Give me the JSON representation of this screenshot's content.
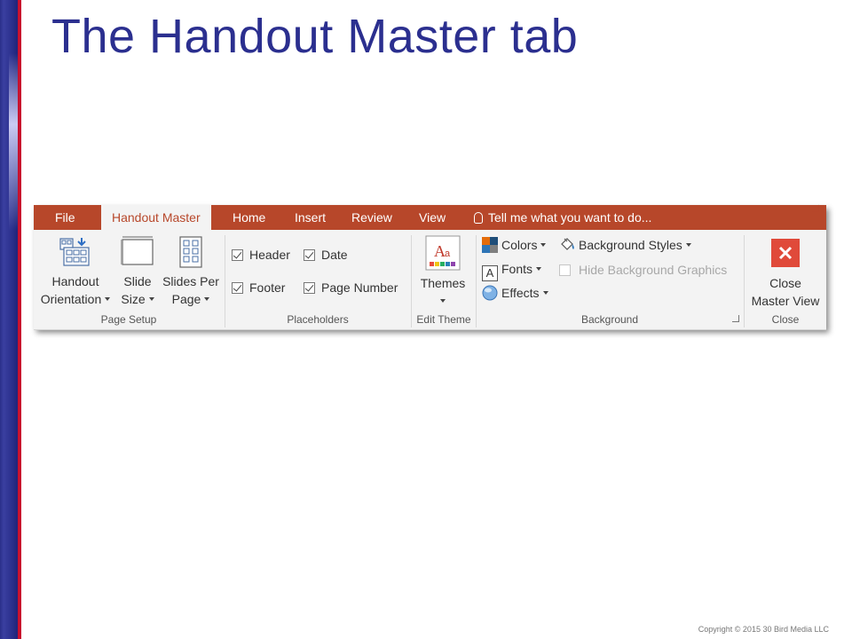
{
  "slide": {
    "title": "The Handout Master tab",
    "copyright": "Copyright © 2015 30 Bird Media LLC"
  },
  "tabs": {
    "file": "File",
    "handout_master": "Handout Master",
    "home": "Home",
    "insert": "Insert",
    "review": "Review",
    "view": "View",
    "tell_me": "Tell me what you want to do..."
  },
  "page_setup": {
    "label": "Page Setup",
    "orientation_line1": "Handout",
    "orientation_line2": "Orientation",
    "slide_size_line1": "Slide",
    "slide_size_line2": "Size",
    "slides_per_page_line1": "Slides Per",
    "slides_per_page_line2": "Page"
  },
  "placeholders": {
    "label": "Placeholders",
    "header": "Header",
    "date": "Date",
    "footer": "Footer",
    "page_number": "Page Number",
    "header_checked": true,
    "date_checked": true,
    "footer_checked": true,
    "page_number_checked": true
  },
  "edit_theme": {
    "label": "Edit Theme",
    "themes": "Themes"
  },
  "background": {
    "label": "Background",
    "colors": "Colors",
    "fonts": "Fonts",
    "effects": "Effects",
    "background_styles": "Background Styles",
    "hide_background_graphics": "Hide Background Graphics"
  },
  "close": {
    "label": "Close",
    "line1": "Close",
    "line2": "Master View"
  },
  "colors": {
    "tab_bar": "#b7472a",
    "title": "#2b2f8f",
    "accent_red": "#c8102e",
    "close_icon": "#e04a3a"
  }
}
